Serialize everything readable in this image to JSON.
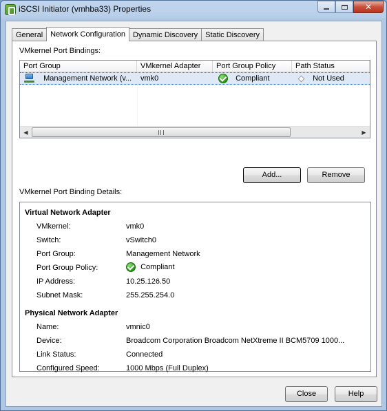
{
  "window": {
    "title": "iSCSI Initiator (vmhba33) Properties",
    "minimize_glyph": "minimize",
    "maximize_glyph": "maximize",
    "close_glyph": "✕"
  },
  "tabs": [
    {
      "label": "General",
      "active": false
    },
    {
      "label": "Network Configuration",
      "active": true
    },
    {
      "label": "Dynamic Discovery",
      "active": false
    },
    {
      "label": "Static Discovery",
      "active": false
    }
  ],
  "bindings": {
    "section_label": "VMkernel Port Bindings:",
    "columns": [
      "Port Group",
      "VMkernel Adapter",
      "Port Group Policy",
      "Path Status"
    ],
    "rows": [
      {
        "port_group": "Management Network (v...",
        "vmkernel_adapter": "vmk0",
        "port_group_policy": "Compliant",
        "path_status": "Not Used",
        "port_group_icon": "network-adapter-icon",
        "policy_icon": "green-check-icon",
        "path_status_icon": "diamond-icon"
      }
    ]
  },
  "buttons": {
    "add": "Add...",
    "remove": "Remove",
    "close": "Close",
    "help": "Help"
  },
  "details": {
    "section_label": "VMkernel Port Binding Details:",
    "virtual_heading": "Virtual Network Adapter",
    "virtual": [
      {
        "label": "VMkernel:",
        "value": "vmk0"
      },
      {
        "label": "Switch:",
        "value": "vSwitch0"
      },
      {
        "label": "Port Group:",
        "value": "Management Network"
      },
      {
        "label": "Port Group Policy:",
        "value": "Compliant"
      },
      {
        "label": "IP Address:",
        "value": "10.25.126.50"
      },
      {
        "label": "Subnet Mask:",
        "value": "255.255.254.0"
      }
    ],
    "physical_heading": "Physical Network Adapter",
    "physical": [
      {
        "label": "Name:",
        "value": "vmnic0"
      },
      {
        "label": "Device:",
        "value": "Broadcom Corporation Broadcom NetXtreme II BCM5709 1000..."
      },
      {
        "label": "Link Status:",
        "value": "Connected"
      },
      {
        "label": "Configured Speed:",
        "value": "1000 Mbps (Full Duplex)"
      }
    ]
  },
  "scrollbar": {
    "left_arrow": "◀",
    "right_arrow": "▶"
  }
}
